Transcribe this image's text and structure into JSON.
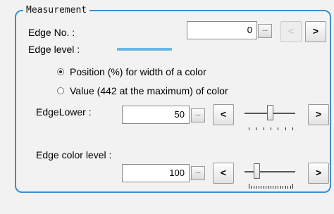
{
  "group": {
    "title": "Measurement"
  },
  "edge_no": {
    "label": "Edge No. :",
    "value": "0",
    "prev_label": "<",
    "next_label": ">",
    "ellipsis": "..."
  },
  "edge_level": {
    "label": "Edge level :",
    "swatch_color": "#6cb8e6"
  },
  "mode": {
    "options": [
      {
        "label": "Position (%) for width of a color",
        "checked": true
      },
      {
        "label": "Value (442 at the maximum) of color",
        "checked": false
      }
    ]
  },
  "edge_lower": {
    "label": "EdgeLower :",
    "value": "50",
    "ellipsis": "...",
    "dec_label": "<",
    "inc_label": ">",
    "slider_fraction": 0.5
  },
  "edge_color_level": {
    "label": "Edge color level :",
    "value": "100",
    "ellipsis": "...",
    "dec_label": "<",
    "inc_label": ">",
    "slider_fraction": 0.23
  }
}
